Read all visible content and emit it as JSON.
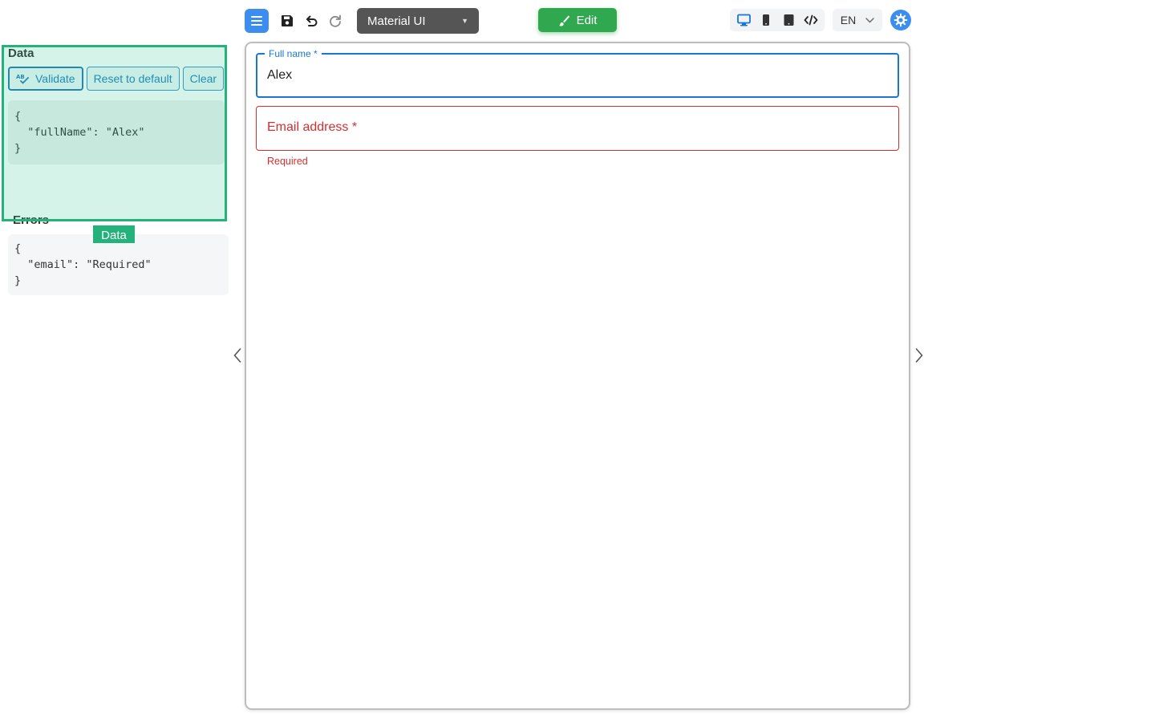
{
  "toolbar": {
    "theme_value": "Material UI",
    "edit_label": "Edit",
    "language_value": "EN"
  },
  "colors": {
    "accent": "#3b8ef0",
    "edit_green": "#2fa84f",
    "highlight": "#23b27a",
    "error": "#d32f2f",
    "focus": "#1976d2"
  },
  "left_panel": {
    "data_title": "Data",
    "buttons": {
      "validate": "Validate",
      "reset": "Reset to default",
      "clear": "Clear"
    },
    "data_json": "{\n  \"fullName\": \"Alex\"\n}",
    "errors_title": "Errors",
    "errors_json": "{\n  \"email\": \"Required\"\n}",
    "highlight_label": "Data"
  },
  "form": {
    "full_name": {
      "label": "Full name",
      "required_mark": "*",
      "value": "Alex"
    },
    "email": {
      "label": "Email address",
      "required_mark": "*",
      "helper": "Required"
    }
  },
  "icons": {
    "menu": "hamburger-icon",
    "save": "save-icon",
    "undo": "undo-icon",
    "redo": "redo-icon",
    "brush": "brush-icon",
    "desktop": "desktop-icon",
    "tablet": "tablet-icon",
    "mobile": "mobile-icon",
    "code": "code-icon",
    "settings": "gear-icon",
    "spellcheck": "spellcheck-icon"
  }
}
